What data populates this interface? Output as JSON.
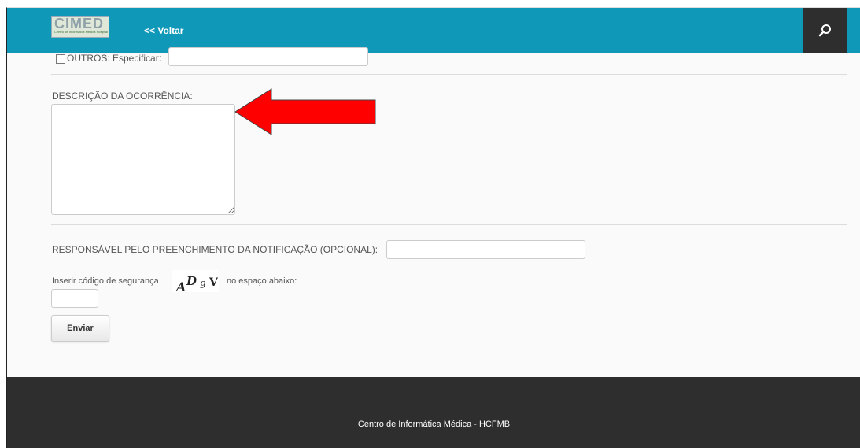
{
  "header": {
    "logo_text": "CIMED",
    "logo_subtitle": "Centro de Informática Médica Hospital das Clínicas - UNESP",
    "back_link": "<< Voltar",
    "search_icon": "search-icon",
    "bar_color": "#0f98b8"
  },
  "form": {
    "outros_label": "OUTROS: Especificar:",
    "outros_value": "",
    "description_label": "DESCRIÇÃO DA OCORRÊNCIA:",
    "description_value": "",
    "responsible_label": "RESPONSÁVEL PELO PREENCHIMENTO DA NOTIFICAÇÃO (OPCIONAL):",
    "responsible_value": "",
    "captcha_prefix": "Inserir código de segurança",
    "captcha_chars": [
      "A",
      "D",
      "9",
      "V"
    ],
    "captcha_suffix": "no espaço abaixo:",
    "captcha_value": "",
    "submit_label": "Enviar"
  },
  "annotation": {
    "arrow_color": "#ff0000",
    "arrow_icon": "red-arrow-left-icon"
  },
  "footer": {
    "text": "Centro de Informática Médica - HCFMB"
  }
}
